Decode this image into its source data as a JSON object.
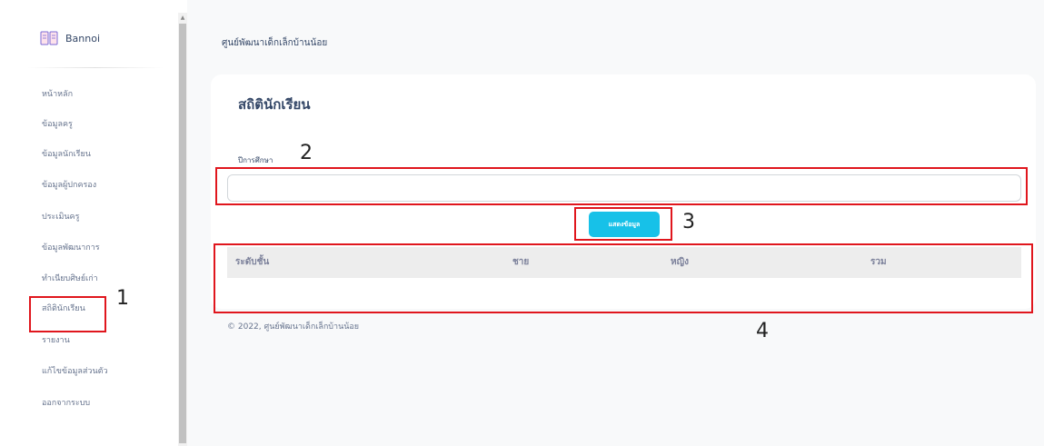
{
  "sidebar": {
    "brand": "Bannoi",
    "items": [
      {
        "label": "หน้าหลัก"
      },
      {
        "label": "ข้อมูลครู"
      },
      {
        "label": "ข้อมูลนักเรียน"
      },
      {
        "label": "ข้อมูลผู้ปกครอง"
      },
      {
        "label": "ประเมินครู"
      },
      {
        "label": "ข้อมูลพัฒนาการ"
      },
      {
        "label": "ทำเนียบศิษย์เก่า"
      },
      {
        "label": "สถิตินักเรียน"
      },
      {
        "label": "รายงาน"
      },
      {
        "label": "แก้ไขข้อมูลส่วนตัว"
      },
      {
        "label": "ออกจากระบบ"
      }
    ]
  },
  "header": {
    "title": "ศูนย์พัฒนาเด็กเล็กบ้านน้อย"
  },
  "card": {
    "title": "สถิตินักเรียน",
    "field_label": "ปีการศึกษา",
    "field_value": "",
    "button_label": "แสดงข้อมูล",
    "table": {
      "columns": [
        "ระดับชั้น",
        "ชาย",
        "หญิง",
        "รวม"
      ],
      "rows": []
    }
  },
  "footer": {
    "text": "© 2022, ศูนย์พัฒนาเด็กเล็กบ้านน้อย"
  },
  "annotations": [
    "1",
    "2",
    "3",
    "4"
  ],
  "colors": {
    "accent": "#17c1e8",
    "annotation": "#e0161d",
    "text_dark": "#344767",
    "text_muted": "#67748e"
  }
}
